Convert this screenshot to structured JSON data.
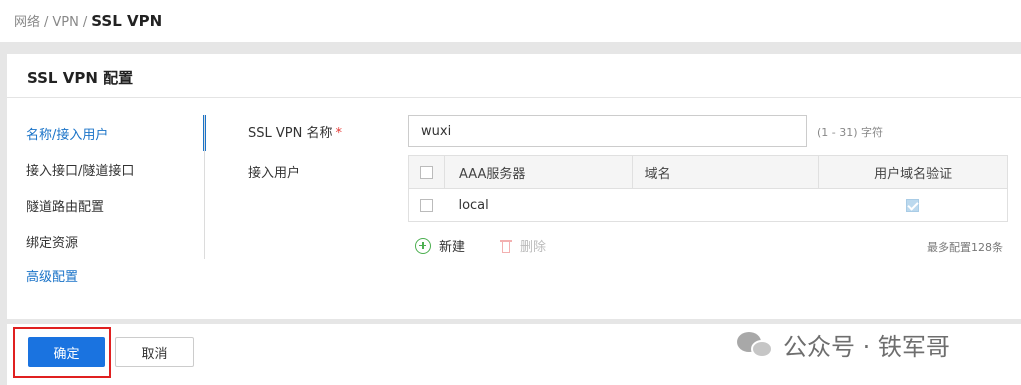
{
  "breadcrumb": {
    "part1": "网络",
    "sep1": "/",
    "part2": "VPN",
    "sep2": "/",
    "current": "SSL VPN"
  },
  "panel": {
    "title": "SSL VPN 配置"
  },
  "side_nav": {
    "items": [
      {
        "label": "名称/接入用户",
        "state": "active"
      },
      {
        "label": "接入接口/隧道接口",
        "state": "normal"
      },
      {
        "label": "隧道路由配置",
        "state": "normal"
      },
      {
        "label": "绑定资源",
        "state": "normal"
      },
      {
        "label": "高级配置",
        "state": "link"
      }
    ]
  },
  "form": {
    "name_label": "SSL VPN 名称",
    "required_mark": "*",
    "name_value": "wuxi",
    "name_hint": "(1 - 31) 字符",
    "users_label": "接入用户"
  },
  "user_table": {
    "headers": {
      "aaa": "AAA服务器",
      "domain": "域名",
      "verify": "用户域名验证"
    },
    "rows": [
      {
        "aaa": "local",
        "domain": "",
        "verify_checked": true
      }
    ]
  },
  "table_actions": {
    "add": "新建",
    "delete": "删除",
    "max_hint": "最多配置128条"
  },
  "footer": {
    "ok": "确定",
    "cancel": "取消"
  },
  "watermark": {
    "text": "公众号 · 铁军哥"
  },
  "colors": {
    "accent": "#1a73e0",
    "highlight": "#e02020",
    "required": "#e53935"
  }
}
